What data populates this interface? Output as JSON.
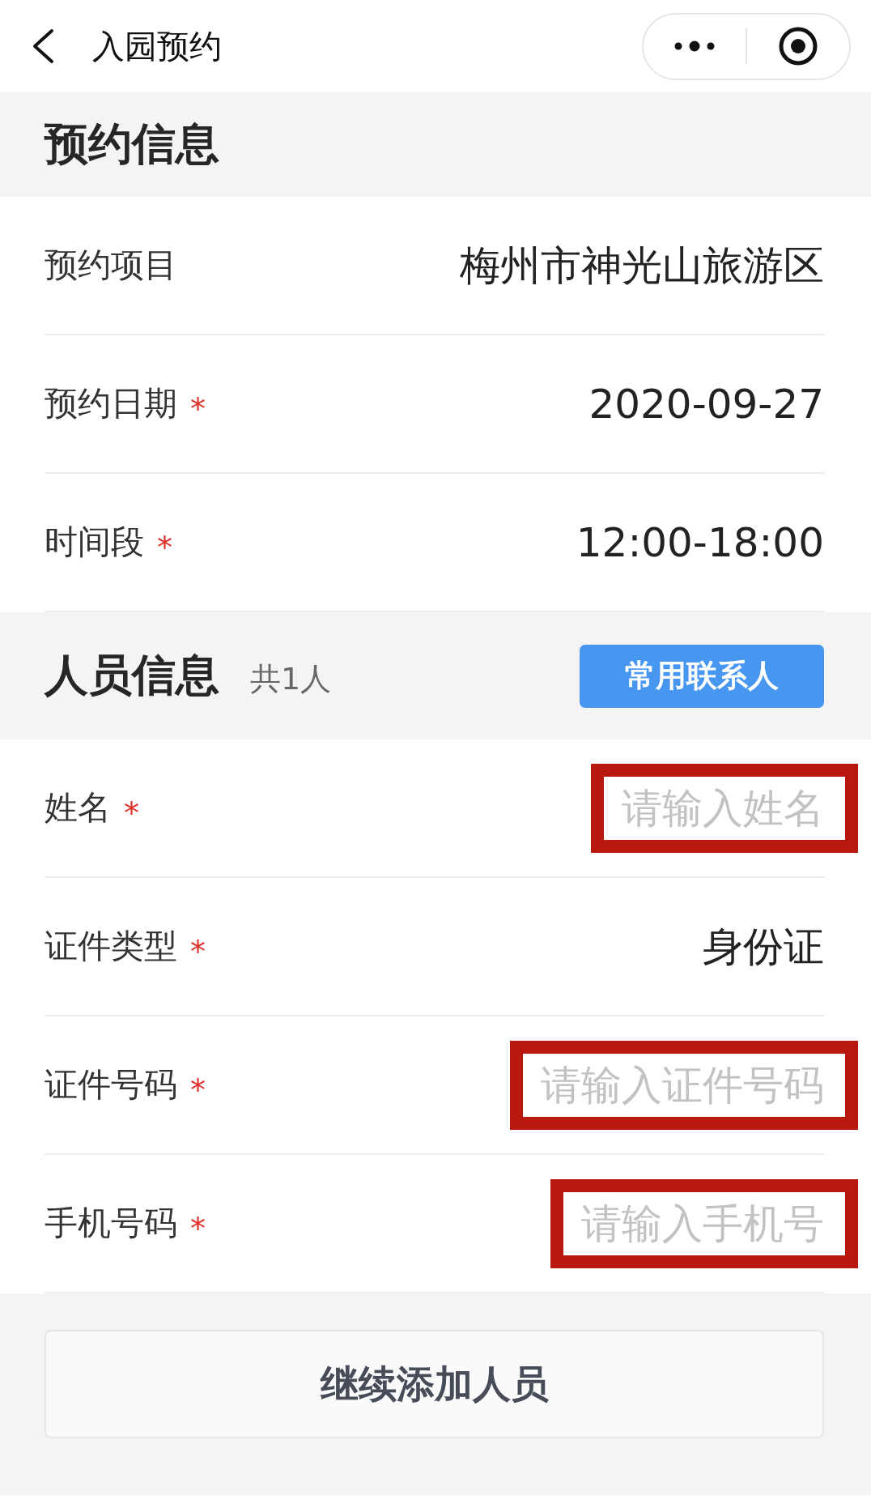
{
  "nav_bar": {
    "title": "入园预约"
  },
  "sections": [
    {
      "title": "预约信息",
      "rows": [
        {
          "label": "预约项目",
          "kind": "text",
          "value": "梅州市神光山旅游区",
          "highlighted": false
        },
        {
          "label": "预约日期",
          "mark": "*",
          "kind": "text",
          "value": "2020-09-27",
          "highlighted": false
        },
        {
          "label": "时间段",
          "mark": "*",
          "kind": "text",
          "value": "12:00-18:00",
          "highlighted": false
        }
      ]
    },
    {
      "title": "人员信息",
      "count": "共1人",
      "action_button": "常用联系人",
      "rows": [
        {
          "label": "姓名",
          "mark": "*",
          "kind": "input",
          "placeholder": "请输入姓名",
          "highlighted": true
        },
        {
          "label": "证件类型",
          "mark": "*",
          "kind": "text",
          "value": "身份证",
          "highlighted": false
        },
        {
          "label": "证件号码",
          "mark": "*",
          "kind": "input",
          "placeholder": "请输入证件号码",
          "highlighted": true
        },
        {
          "label": "手机号码",
          "mark": "*",
          "kind": "input",
          "placeholder": "请输入手机号",
          "highlighted": true
        }
      ]
    }
  ],
  "add_person_button": "继续添加人员"
}
